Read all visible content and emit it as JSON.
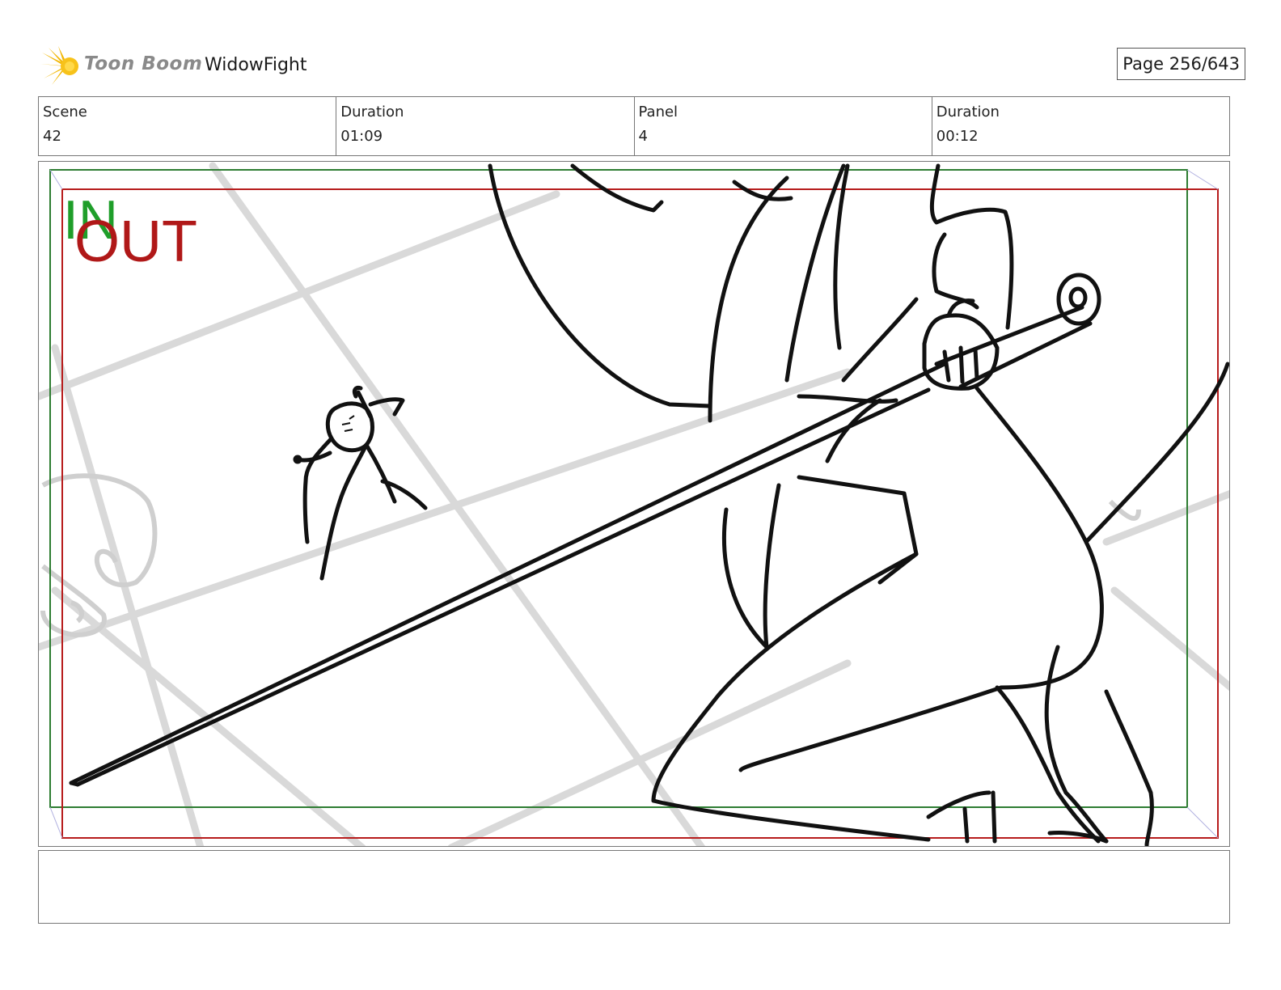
{
  "header": {
    "logo_text": "Toon Boom",
    "project_title": "WidowFight",
    "page_label": "Page 256/643"
  },
  "info": {
    "scene_label": "Scene",
    "scene_value": "42",
    "scene_duration_label": "Duration",
    "scene_duration_value": "01:09",
    "panel_label": "Panel",
    "panel_value": "4",
    "panel_duration_label": "Duration",
    "panel_duration_value": "00:12"
  },
  "frame_markers": {
    "in_label": "IN",
    "out_label": "OUT",
    "in_color": "#1f9e2a",
    "out_color": "#b01818"
  },
  "notes": {
    "text": ""
  }
}
